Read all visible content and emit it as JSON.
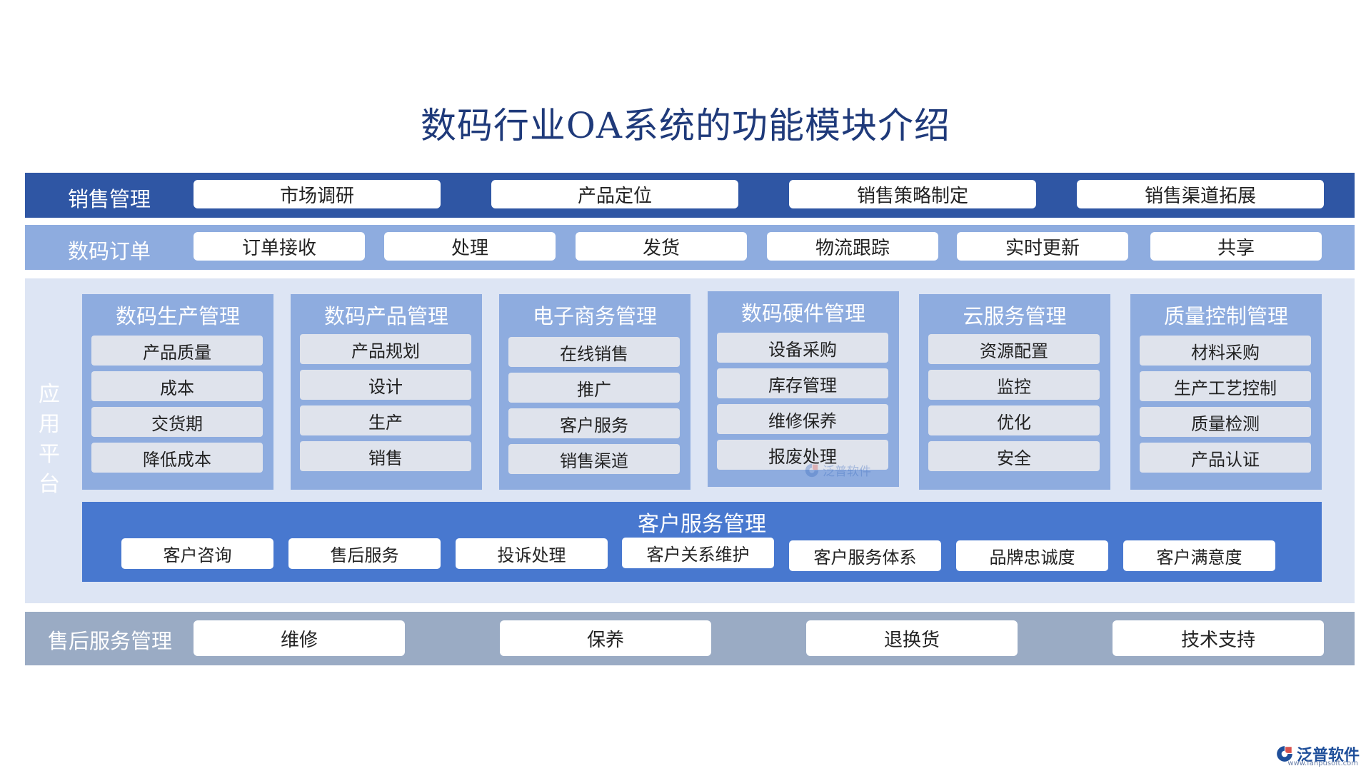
{
  "title": "数码行业OA系统的功能模块介绍",
  "sales": {
    "label": "销售管理",
    "items": [
      "市场调研",
      "产品定位",
      "销售策略制定",
      "销售渠道拓展"
    ]
  },
  "orders": {
    "label": "数码订单",
    "items": [
      "订单接收",
      "处理",
      "发货",
      "物流跟踪",
      "实时更新",
      "共享"
    ]
  },
  "platform": {
    "label": "应用平台",
    "modules": [
      {
        "title": "数码生产管理",
        "items": [
          "产品质量",
          "成本",
          "交货期",
          "降低成本"
        ]
      },
      {
        "title": "数码产品管理",
        "items": [
          "产品规划",
          "设计",
          "生产",
          "销售"
        ]
      },
      {
        "title": "电子商务管理",
        "items": [
          "在线销售",
          "推广",
          "客户服务",
          "销售渠道"
        ]
      },
      {
        "title": "数码硬件管理",
        "items": [
          "设备采购",
          "库存管理",
          "维修保养",
          "报废处理"
        ]
      },
      {
        "title": "云服务管理",
        "items": [
          "资源配置",
          "监控",
          "优化",
          "安全"
        ]
      },
      {
        "title": "质量控制管理",
        "items": [
          "材料采购",
          "生产工艺控制",
          "质量检测",
          "产品认证"
        ]
      }
    ],
    "customer_service": {
      "title": "客户服务管理",
      "items": [
        "客户咨询",
        "售后服务",
        "投诉处理",
        "客户关系维护",
        "客户服务体系",
        "品牌忠诚度",
        "客户满意度"
      ]
    }
  },
  "after_sales": {
    "label": "售后服务管理",
    "items": [
      "维修",
      "保养",
      "退换货",
      "技术支持"
    ]
  },
  "brand": {
    "name": "泛普软件",
    "url": "www.fanpusoft.com",
    "watermark": "泛普软件"
  },
  "colors": {
    "sales_band": "#2f56a4",
    "orders_band": "#8eacdf",
    "platform_bg": "#dde5f4",
    "module_bg": "#8eacdf",
    "customer_service_bg": "#4878cf",
    "after_sales_band": "#9aabc4",
    "title": "#1f3a7a"
  }
}
